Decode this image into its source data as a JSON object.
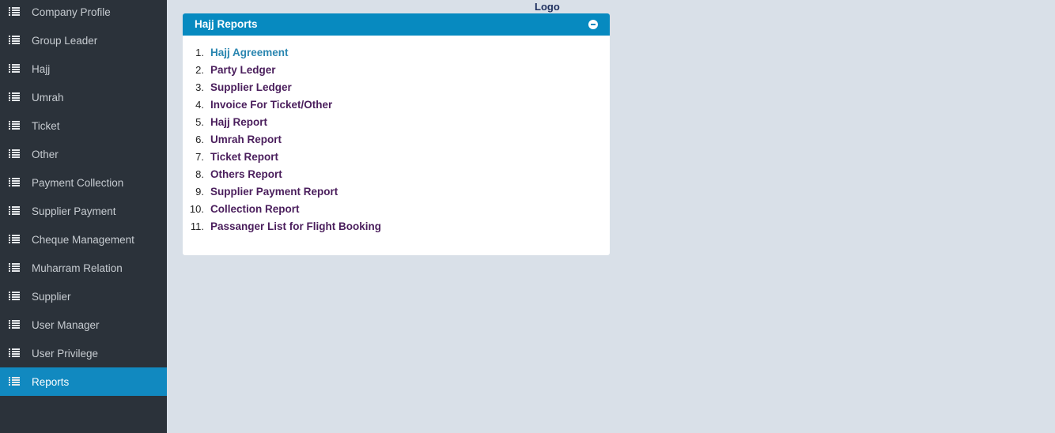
{
  "sidebar": {
    "items": [
      {
        "label": "Company Profile",
        "icon": "list-icon",
        "active": false
      },
      {
        "label": "Group Leader",
        "icon": "list-icon",
        "active": false
      },
      {
        "label": "Hajj",
        "icon": "list-icon",
        "active": false
      },
      {
        "label": "Umrah",
        "icon": "list-icon",
        "active": false
      },
      {
        "label": "Ticket",
        "icon": "list-icon",
        "active": false
      },
      {
        "label": "Other",
        "icon": "list-icon",
        "active": false
      },
      {
        "label": "Payment Collection",
        "icon": "list-icon",
        "active": false
      },
      {
        "label": "Supplier Payment",
        "icon": "list-icon",
        "active": false
      },
      {
        "label": "Cheque Management",
        "icon": "list-icon",
        "active": false
      },
      {
        "label": "Muharram Relation",
        "icon": "list-icon",
        "active": false
      },
      {
        "label": "Supplier",
        "icon": "list-icon",
        "active": false
      },
      {
        "label": "User Manager",
        "icon": "list-icon",
        "active": false
      },
      {
        "label": "User Privilege",
        "icon": "list-icon",
        "active": false
      },
      {
        "label": "Reports",
        "icon": "list-icon",
        "active": true
      }
    ]
  },
  "header": {
    "logo_text": "Logo"
  },
  "panel": {
    "title": "Hajj Reports",
    "collapse_icon": "minus-circle-icon",
    "reports": [
      {
        "num": "1.",
        "label": "Hajj Agreement",
        "active": true
      },
      {
        "num": "2.",
        "label": "Party Ledger",
        "active": false
      },
      {
        "num": "3.",
        "label": "Supplier Ledger",
        "active": false
      },
      {
        "num": "4.",
        "label": "Invoice For Ticket/Other",
        "active": false
      },
      {
        "num": "5.",
        "label": "Hajj Report",
        "active": false
      },
      {
        "num": "6.",
        "label": "Umrah Report",
        "active": false
      },
      {
        "num": "7.",
        "label": "Ticket Report",
        "active": false
      },
      {
        "num": "8.",
        "label": "Others Report",
        "active": false
      },
      {
        "num": "9.",
        "label": "Supplier Payment Report",
        "active": false
      },
      {
        "num": "10.",
        "label": "Collection Report",
        "active": false
      },
      {
        "num": "11.",
        "label": "Passanger List for Flight Booking",
        "active": false
      }
    ]
  },
  "colors": {
    "sidebar_bg": "#2b323a",
    "sidebar_active": "#1189c0",
    "page_bg": "#d9e0e8",
    "panel_header": "#078ac0",
    "link": "#4a1e5c",
    "link_active": "#2a86b0"
  }
}
